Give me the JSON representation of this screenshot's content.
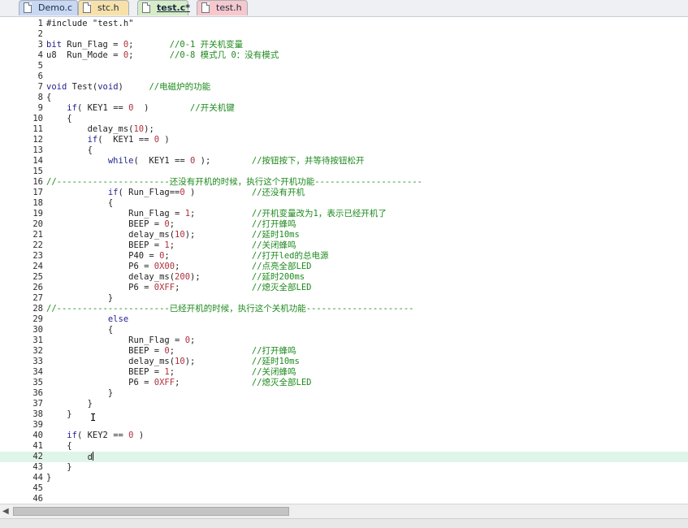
{
  "tabs": [
    {
      "label": "Demo.c",
      "color": "#c9d8f2",
      "active": false
    },
    {
      "label": "stc.h",
      "color": "#f8e1a8",
      "active": false
    },
    {
      "label": "test.c*",
      "color": "#d6ecc6",
      "active": true
    },
    {
      "label": "test.h",
      "color": "#f6c8cc",
      "active": false
    }
  ],
  "editor": {
    "current_line": 42,
    "lines": [
      [
        [
          "d",
          "#include \"test.h\""
        ]
      ],
      [],
      [
        [
          "k",
          "bit"
        ],
        [
          "t",
          " Run_Flag = "
        ],
        [
          "n",
          "0"
        ],
        [
          "t",
          ";       "
        ],
        [
          "c",
          "//0-1 开关机变量"
        ]
      ],
      [
        [
          "t",
          "u8  Run_Mode = "
        ],
        [
          "n",
          "0"
        ],
        [
          "t",
          ";       "
        ],
        [
          "c",
          "//0-8 模式几 0：没有模式"
        ]
      ],
      [],
      [],
      [
        [
          "k",
          "void"
        ],
        [
          "t",
          " Test("
        ],
        [
          "k",
          "void"
        ],
        [
          "t",
          ")     "
        ],
        [
          "c",
          "//电磁炉的功能"
        ]
      ],
      [
        [
          "t",
          "{"
        ]
      ],
      [
        [
          "t",
          "    "
        ],
        [
          "k",
          "if"
        ],
        [
          "t",
          "( KEY1 == "
        ],
        [
          "n",
          "0"
        ],
        [
          "t",
          "  )        "
        ],
        [
          "c",
          "//开关机键"
        ]
      ],
      [
        [
          "t",
          "    {"
        ]
      ],
      [
        [
          "t",
          "        delay_ms("
        ],
        [
          "n",
          "10"
        ],
        [
          "t",
          ");"
        ]
      ],
      [
        [
          "t",
          "        "
        ],
        [
          "k",
          "if"
        ],
        [
          "t",
          "(  KEY1 == "
        ],
        [
          "n",
          "0"
        ],
        [
          "t",
          " )"
        ]
      ],
      [
        [
          "t",
          "        {"
        ]
      ],
      [
        [
          "t",
          "            "
        ],
        [
          "k",
          "while"
        ],
        [
          "t",
          "(  KEY1 == "
        ],
        [
          "n",
          "0"
        ],
        [
          "t",
          " );        "
        ],
        [
          "c",
          "//按钮按下，并等待按钮松开"
        ]
      ],
      [],
      [
        [
          "c",
          "//----------------------还没有开机的时候，执行这个开机功能---------------------"
        ]
      ],
      [
        [
          "t",
          "            "
        ],
        [
          "k",
          "if"
        ],
        [
          "t",
          "( Run_Flag=="
        ],
        [
          "n",
          "0"
        ],
        [
          "t",
          " )           "
        ],
        [
          "c",
          "//还没有开机"
        ]
      ],
      [
        [
          "t",
          "            {"
        ]
      ],
      [
        [
          "t",
          "                Run_Flag = "
        ],
        [
          "n",
          "1"
        ],
        [
          "t",
          ";           "
        ],
        [
          "c",
          "//开机变量改为1，表示已经开机了"
        ]
      ],
      [
        [
          "t",
          "                BEEP = "
        ],
        [
          "n",
          "0"
        ],
        [
          "t",
          ";               "
        ],
        [
          "c",
          "//打开蜂鸣"
        ]
      ],
      [
        [
          "t",
          "                delay_ms("
        ],
        [
          "n",
          "10"
        ],
        [
          "t",
          ");           "
        ],
        [
          "c",
          "//延时10ms"
        ]
      ],
      [
        [
          "t",
          "                BEEP = "
        ],
        [
          "n",
          "1"
        ],
        [
          "t",
          ";               "
        ],
        [
          "c",
          "//关闭蜂鸣"
        ]
      ],
      [
        [
          "t",
          "                P40 = "
        ],
        [
          "n",
          "0"
        ],
        [
          "t",
          ";                "
        ],
        [
          "c",
          "//打开led的总电源"
        ]
      ],
      [
        [
          "t",
          "                P6 = "
        ],
        [
          "n",
          "0X00"
        ],
        [
          "t",
          ";              "
        ],
        [
          "c",
          "//点亮全部LED"
        ]
      ],
      [
        [
          "t",
          "                delay_ms("
        ],
        [
          "n",
          "200"
        ],
        [
          "t",
          ");          "
        ],
        [
          "c",
          "//延时200ms"
        ]
      ],
      [
        [
          "t",
          "                P6 = "
        ],
        [
          "n",
          "0XFF"
        ],
        [
          "t",
          ";              "
        ],
        [
          "c",
          "//熄灭全部LED"
        ]
      ],
      [
        [
          "t",
          "            }"
        ]
      ],
      [
        [
          "c",
          "//----------------------已经开机的时候，执行这个关机功能---------------------"
        ]
      ],
      [
        [
          "t",
          "            "
        ],
        [
          "k",
          "else"
        ]
      ],
      [
        [
          "t",
          "            {"
        ]
      ],
      [
        [
          "t",
          "                Run_Flag = "
        ],
        [
          "n",
          "0"
        ],
        [
          "t",
          ";"
        ]
      ],
      [
        [
          "t",
          "                BEEP = "
        ],
        [
          "n",
          "0"
        ],
        [
          "t",
          ";               "
        ],
        [
          "c",
          "//打开蜂鸣"
        ]
      ],
      [
        [
          "t",
          "                delay_ms("
        ],
        [
          "n",
          "10"
        ],
        [
          "t",
          ");           "
        ],
        [
          "c",
          "//延时10ms"
        ]
      ],
      [
        [
          "t",
          "                BEEP = "
        ],
        [
          "n",
          "1"
        ],
        [
          "t",
          ";               "
        ],
        [
          "c",
          "//关闭蜂鸣"
        ]
      ],
      [
        [
          "t",
          "                P6 = "
        ],
        [
          "n",
          "0XFF"
        ],
        [
          "t",
          ";              "
        ],
        [
          "c",
          "//熄灭全部LED"
        ]
      ],
      [
        [
          "t",
          "            }"
        ]
      ],
      [
        [
          "t",
          "        }"
        ]
      ],
      [
        [
          "t",
          "    }"
        ]
      ],
      [],
      [
        [
          "t",
          "    "
        ],
        [
          "k",
          "if"
        ],
        [
          "t",
          "( KEY2 == "
        ],
        [
          "n",
          "0"
        ],
        [
          "t",
          " )"
        ]
      ],
      [
        [
          "t",
          "    {"
        ]
      ],
      [
        [
          "t",
          "        d"
        ],
        [
          "caret",
          ""
        ]
      ],
      [
        [
          "t",
          "    }"
        ]
      ],
      [
        [
          "t",
          "}"
        ]
      ],
      [],
      []
    ]
  },
  "ibeam_glyph": "I",
  "scroll_left_glyph": "◀"
}
